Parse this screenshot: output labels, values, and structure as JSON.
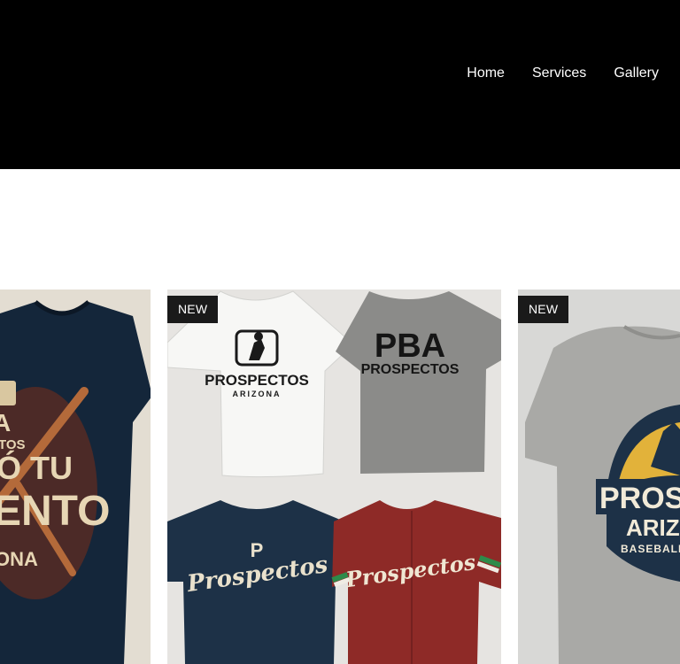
{
  "nav": {
    "items": [
      {
        "label": "Home"
      },
      {
        "label": "Services"
      },
      {
        "label": "Gallery"
      }
    ]
  },
  "products": [
    {
      "shirt_text": {
        "line_a": "A",
        "line_b": "TOS",
        "line_c": "Ó TU",
        "line_d": "ENTO",
        "line_e": "ONA"
      }
    },
    {
      "badge": "NEW",
      "shirts": {
        "white_title": "PROSPECTOS",
        "white_sub": "ARIZONA",
        "gray_title": "PBA",
        "gray_sub": "PROSPECTOS",
        "navy_letter": "P",
        "navy_script": "Prospectos",
        "red_script": "Prospectos"
      }
    },
    {
      "badge": "NEW",
      "shirt_text": {
        "title": "PROSP",
        "sub": "ARIZ",
        "small": "BASEBALL"
      }
    }
  ],
  "colors": {
    "header_bg": "#000000",
    "badge_bg": "#1a1a1a",
    "navy_shirt": "#1d3147",
    "red_shirt": "#8e2a27",
    "gray_shirt": "#8b8b89",
    "accent_gold": "#e2b23a"
  }
}
